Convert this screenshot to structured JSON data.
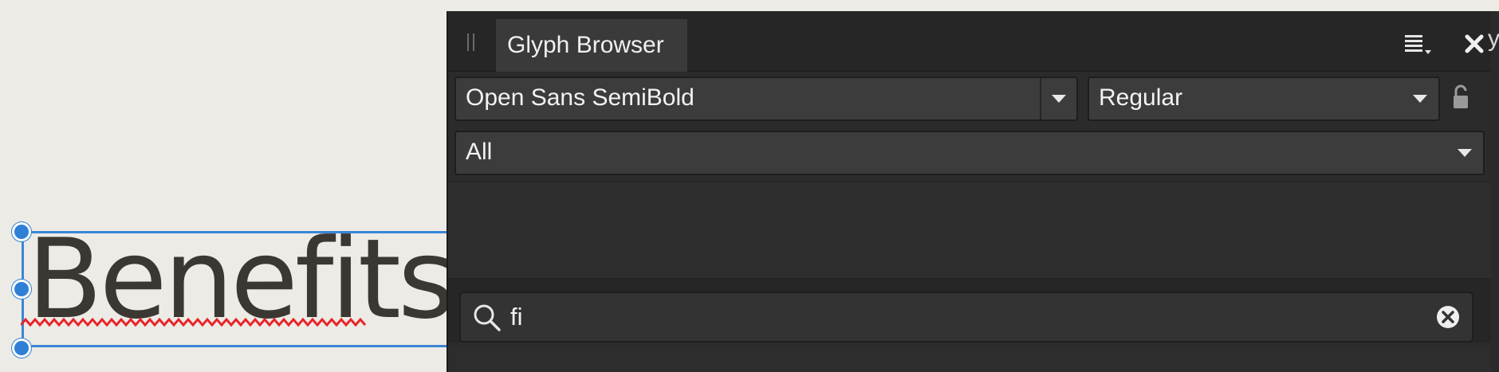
{
  "canvas": {
    "text": "Benefits",
    "spellcheck_color": "#e8252a",
    "selection_color": "#3a86d8"
  },
  "panel": {
    "tab_label": "Glyph Browser",
    "menu_icon": "panel-menu-icon",
    "close_icon": "close-icon",
    "font_family": "Open Sans SemiBold",
    "font_style": "Regular",
    "lock_icon": "lock-icon",
    "category": "All",
    "search": {
      "icon": "search-icon",
      "value": "fi",
      "clear_icon": "clear-search-icon"
    }
  },
  "edge": {
    "partial_char": "y"
  },
  "colors": {
    "panel_bg": "#2b2b2b",
    "field_bg": "#3c3c3c",
    "canvas_bg": "#edebe6"
  }
}
